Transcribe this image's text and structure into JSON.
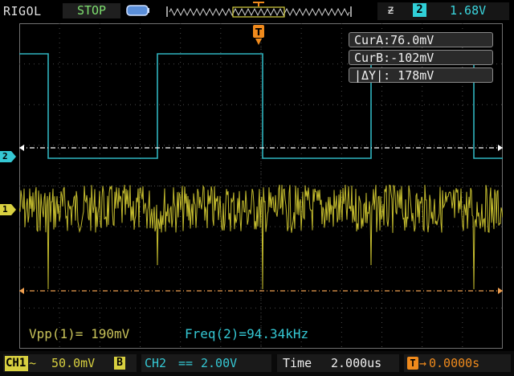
{
  "top_bar": {
    "brand": "RIGOL",
    "run_status": "STOP",
    "trigger_symbol": "ƶ",
    "trigger_source": "2",
    "trigger_level": "1.68V"
  },
  "cursors": {
    "cur_a": "CurA:76.0mV",
    "cur_b": "CurB:-102mV",
    "delta_y": "|ΔY|:  178mV"
  },
  "markers": {
    "ch1": "1",
    "ch2": "2",
    "trigger": "T"
  },
  "measurements": {
    "vpp": "Vpp(1)= 190mV",
    "freq": "Freq(2)=94.34kHz"
  },
  "bottom_bar": {
    "ch1_label": "CH1",
    "ch1_coupling": "~",
    "ch1_scale": "50.0mV",
    "ch1_bw": "B",
    "ch2_label": "CH2",
    "ch2_coupling": "==",
    "ch2_scale": "2.00V",
    "timebase_label": "Time",
    "timebase_value": "2.000us",
    "trigger_position_icon": "T",
    "trigger_position_arrow": "→",
    "trigger_position_value": "0.0000s"
  },
  "colors": {
    "ch1": "#d8d040",
    "ch2": "#35c8d4",
    "trigger": "#f08a1c",
    "grid": "#5a5a5a"
  }
}
